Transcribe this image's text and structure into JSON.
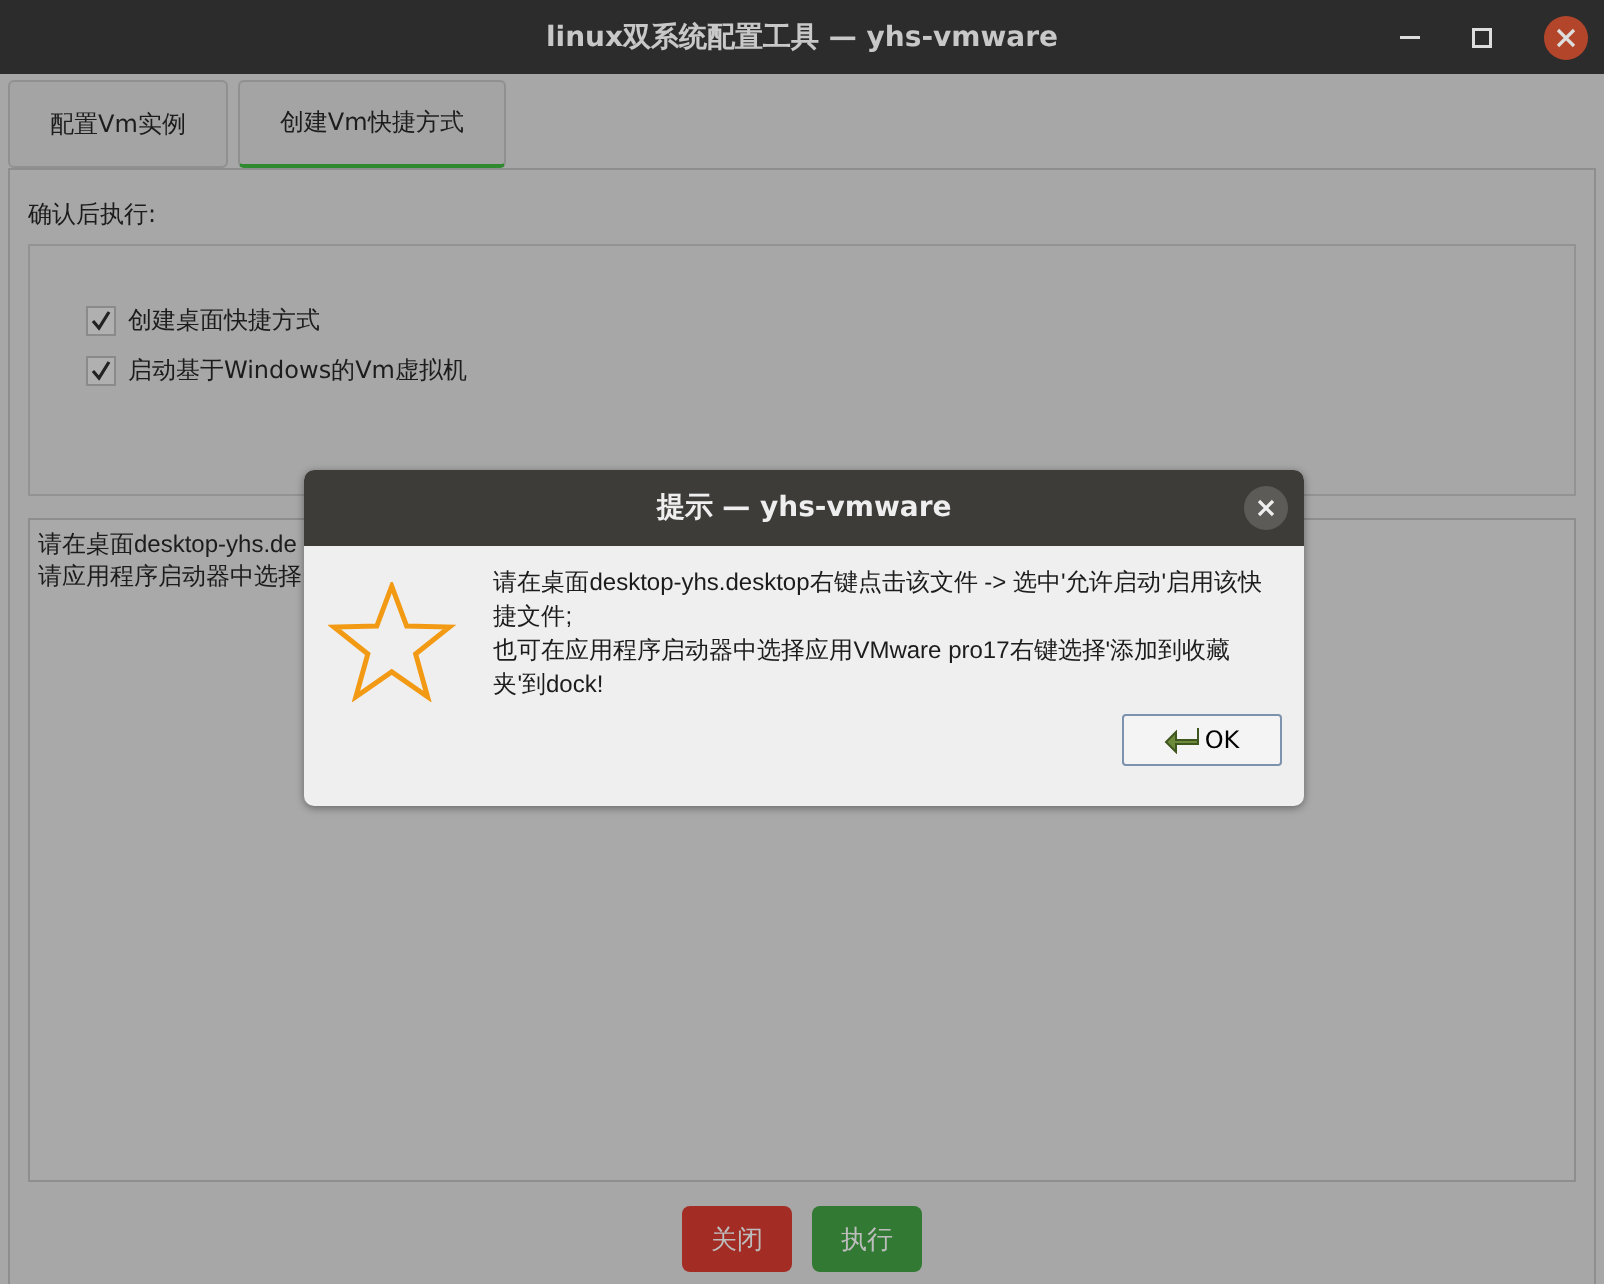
{
  "window": {
    "title": "linux双系统配置工具 — yhs-vmware"
  },
  "tabs": [
    {
      "label": "配置Vm实例",
      "selected": false
    },
    {
      "label": "创建Vm快捷方式",
      "selected": true
    }
  ],
  "group": {
    "title": "确认后执行:",
    "options": [
      {
        "label": "创建桌面快捷方式",
        "checked": true
      },
      {
        "label": "启动基于Windows的Vm虚拟机",
        "checked": true
      }
    ]
  },
  "log": {
    "lines": [
      "请在桌面desktop-yhs.de",
      "请应用程序启动器中选择"
    ]
  },
  "buttons": [
    {
      "label": "关闭",
      "kind": "danger"
    },
    {
      "label": "执行",
      "kind": "primary"
    }
  ],
  "dialog": {
    "title": "提示 — yhs-vmware",
    "message": "请在桌面desktop-yhs.desktop右键点击该文件 -> 选中'允许启动'启用该快捷文件;\n也可在应用程序启动器中选择应用VMware pro17右键选择'添加到收藏夹'到dock!",
    "button": "OK"
  }
}
